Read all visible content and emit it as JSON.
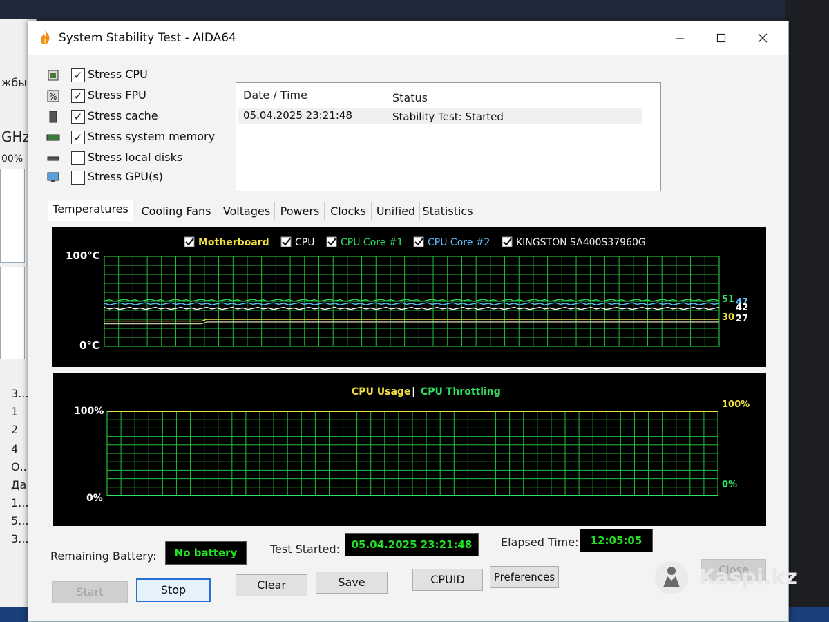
{
  "window": {
    "title": "System Stability Test - AIDA64"
  },
  "background_app": {
    "fragments": [
      "жбы",
      "GHz",
      "00%",
      "3...",
      "1",
      "2",
      "4",
      "О...",
      "Да",
      "1...",
      "5...",
      "3..."
    ]
  },
  "stress_options": [
    {
      "label": "Stress CPU",
      "checked": true,
      "icon": "cpu-chip-icon"
    },
    {
      "label": "Stress FPU",
      "checked": true,
      "icon": "fpu-percent-icon"
    },
    {
      "label": "Stress cache",
      "checked": true,
      "icon": "cache-chip-icon"
    },
    {
      "label": "Stress system memory",
      "checked": true,
      "icon": "memory-module-icon"
    },
    {
      "label": "Stress local disks",
      "checked": false,
      "icon": "disk-drive-icon"
    },
    {
      "label": "Stress GPU(s)",
      "checked": false,
      "icon": "monitor-gpu-icon"
    }
  ],
  "log": {
    "headers": {
      "date": "Date / Time",
      "status": "Status"
    },
    "rows": [
      {
        "date": "05.04.2025 23:21:48",
        "status": "Stability Test: Started"
      }
    ]
  },
  "tabs": [
    "Temperatures",
    "Cooling Fans",
    "Voltages",
    "Powers",
    "Clocks",
    "Unified",
    "Statistics"
  ],
  "active_tab": "Temperatures",
  "temperature_chart": {
    "legend": [
      {
        "label": "Motherboard",
        "checked": true,
        "color": "#f0e040"
      },
      {
        "label": "CPU",
        "checked": true,
        "color": "#ffffff"
      },
      {
        "label": "CPU Core #1",
        "checked": true,
        "color": "#30e060"
      },
      {
        "label": "CPU Core #2",
        "checked": true,
        "color": "#60c0ff"
      },
      {
        "label": "KINGSTON SA400S37960G",
        "checked": true,
        "color": "#f0f0f0"
      }
    ],
    "y_top_label": "100°C",
    "y_bottom_label": "0°C",
    "value_labels": [
      "51",
      "47",
      "42",
      "30",
      "27"
    ]
  },
  "usage_chart": {
    "title_usage": "CPU Usage",
    "separator": "|",
    "title_throttling": "CPU Throttling",
    "left_top": "100%",
    "left_bottom": "0%",
    "right_top": "100%",
    "right_bottom": "0%"
  },
  "chart_data": [
    {
      "type": "line",
      "ylim": [
        0,
        100
      ],
      "grid": true,
      "legend_position": "top-center",
      "series": [
        {
          "name": "Motherboard",
          "final_value": 30
        },
        {
          "name": "CPU",
          "final_value": 47
        },
        {
          "name": "CPU Core #1",
          "final_value": 51
        },
        {
          "name": "CPU Core #2",
          "final_value": 42
        },
        {
          "name": "KINGSTON SA400S37960G",
          "final_value": 27
        }
      ]
    },
    {
      "type": "line",
      "ylim": [
        0,
        100
      ],
      "grid": true,
      "series": [
        {
          "name": "CPU Usage",
          "final_value": 100
        },
        {
          "name": "CPU Throttling",
          "final_value": 0
        }
      ]
    }
  ],
  "status": {
    "battery_label": "Remaining Battery:",
    "battery_value": "No battery",
    "started_label": "Test Started:",
    "started_value": "05.04.2025 23:21:48",
    "elapsed_label": "Elapsed Time:",
    "elapsed_value": "12:05:05"
  },
  "buttons": {
    "start": "Start",
    "stop": "Stop",
    "clear": "Clear",
    "save": "Save",
    "cpuid": "CPUID",
    "preferences": "Preferences",
    "close": "Close"
  },
  "watermark": {
    "text": "Kaspi.kz"
  }
}
